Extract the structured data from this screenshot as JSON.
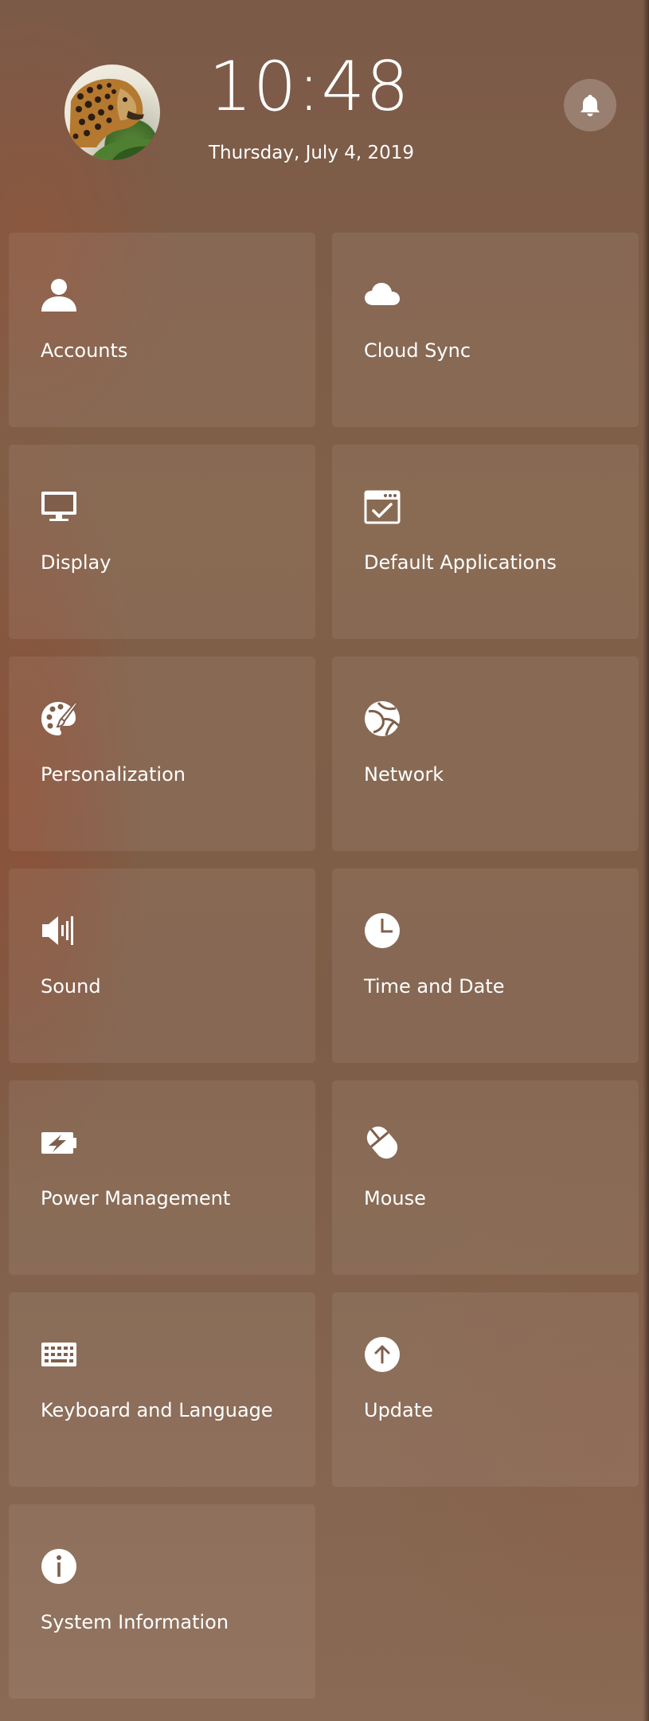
{
  "header": {
    "time": "10:48",
    "date": "Thursday, July 4, 2019",
    "avatar": "leopard-avatar",
    "notification_icon": "bell-icon"
  },
  "tiles": [
    {
      "label": "Accounts",
      "icon": "user-icon"
    },
    {
      "label": "Cloud Sync",
      "icon": "cloud-icon"
    },
    {
      "label": "Display",
      "icon": "monitor-icon"
    },
    {
      "label": "Default Applications",
      "icon": "default-apps-icon"
    },
    {
      "label": "Personalization",
      "icon": "palette-icon"
    },
    {
      "label": "Network",
      "icon": "globe-icon"
    },
    {
      "label": "Sound",
      "icon": "speaker-icon"
    },
    {
      "label": "Time and Date",
      "icon": "clock-icon"
    },
    {
      "label": "Power Management",
      "icon": "battery-icon"
    },
    {
      "label": "Mouse",
      "icon": "mouse-icon"
    },
    {
      "label": "Keyboard and Language",
      "icon": "keyboard-icon"
    },
    {
      "label": "Update",
      "icon": "update-icon"
    },
    {
      "label": "System Information",
      "icon": "info-icon"
    }
  ]
}
